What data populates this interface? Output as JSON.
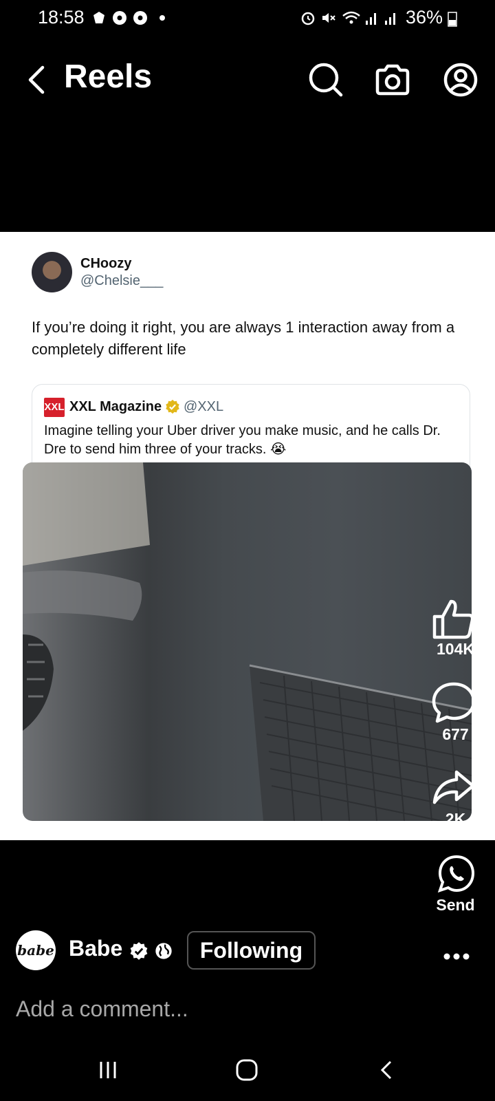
{
  "status_bar": {
    "time": "18:58",
    "battery": "36%"
  },
  "header": {
    "title": "Reels"
  },
  "post": {
    "author_name": "CHoozy",
    "author_handle": "@Chelsie___",
    "text": "If you’re doing it right, you are always 1 interaction away from a completely different life",
    "quote": {
      "logo": "XXL",
      "name": "XXL Magazine",
      "handle": "@XXL",
      "text": "Imagine telling your Uber driver you make music, and he calls Dr. Dre to send him three of your tracks. 😭"
    }
  },
  "actions": {
    "likes": "104K",
    "comments": "677",
    "shares": "2K",
    "send_label": "Send"
  },
  "account": {
    "avatar_text": "babe",
    "name": "Babe",
    "follow_label": "Following"
  },
  "comment": {
    "placeholder": "Add a comment..."
  },
  "colors": {
    "background": "#000000",
    "card": "#ffffff",
    "verified_gold": "#e2b719",
    "xxl_red": "#d6202b"
  }
}
